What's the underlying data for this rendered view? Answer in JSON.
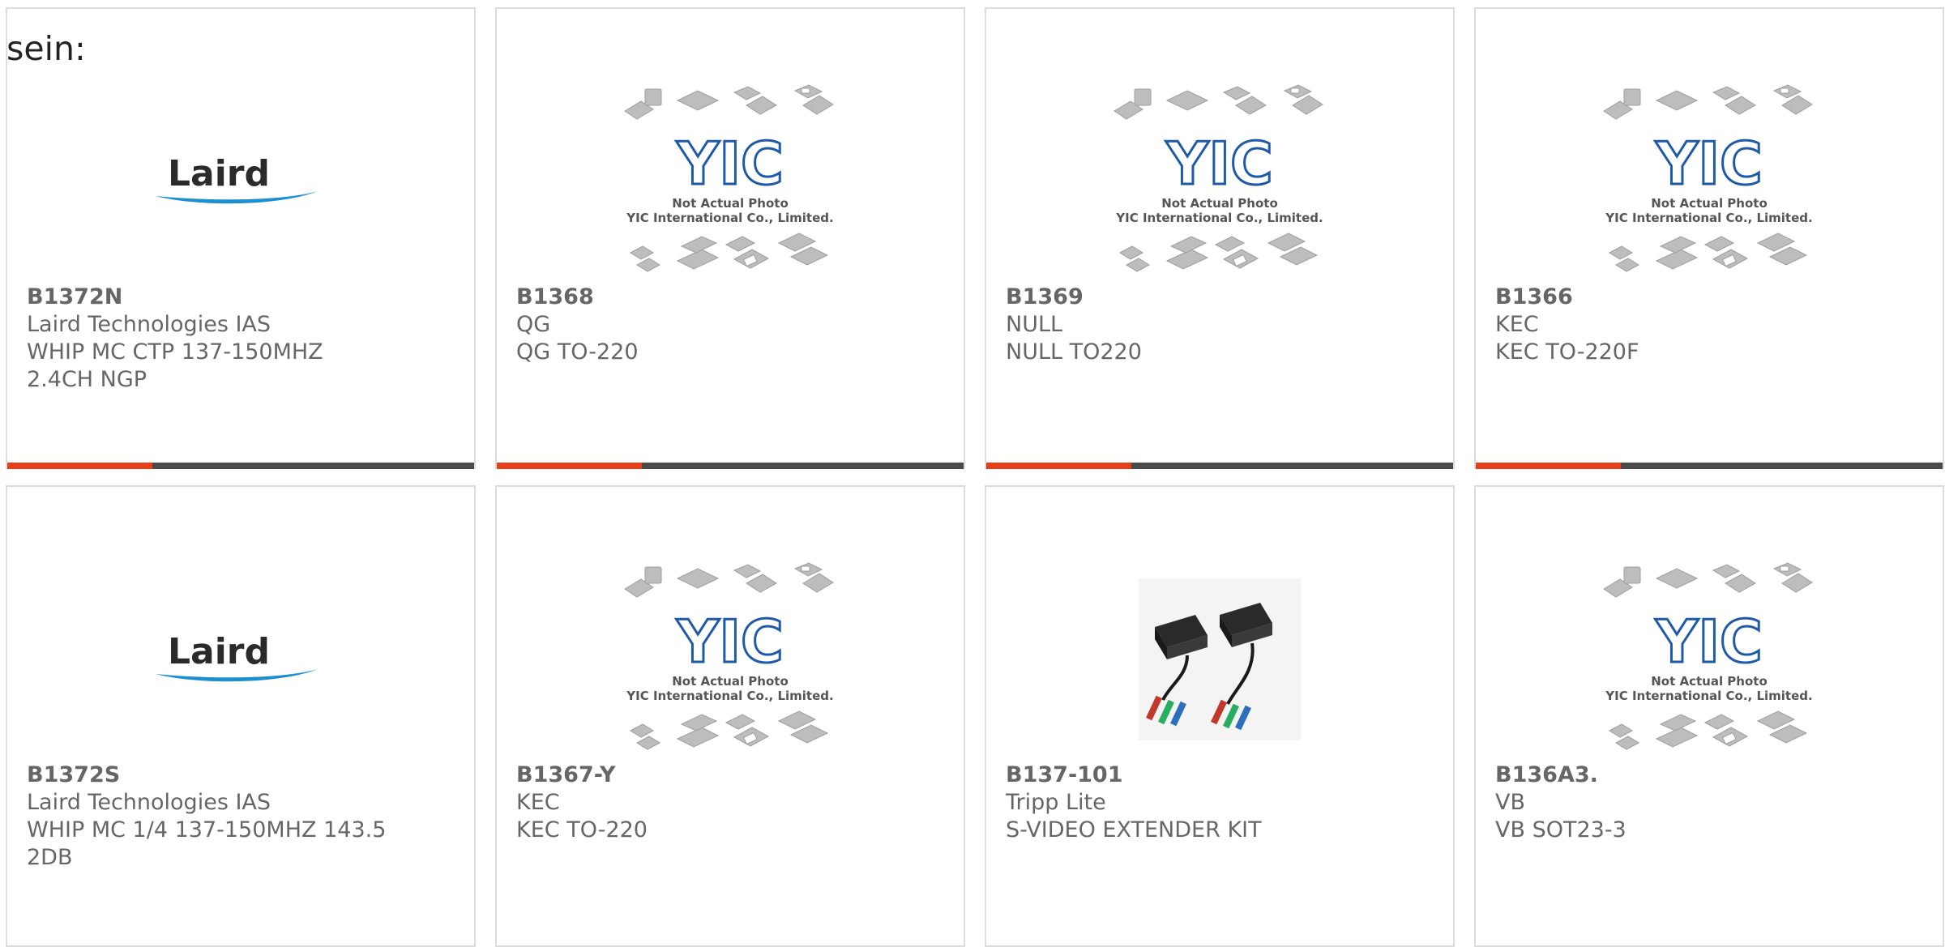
{
  "intro_text": "sein:",
  "photo_caption": {
    "line1": "Not Actual Photo",
    "line2": "YIC International Co., Limited.",
    "logo": "YIC"
  },
  "laird_logo": "Laird",
  "colors": {
    "accent_bar": "#e5401a",
    "bar_track": "#4a4a4a",
    "card_border": "#dcdcdc",
    "text": "#666666"
  },
  "products": [
    {
      "part": "B1372N",
      "manufacturer": "Laird Technologies IAS",
      "desc_line1": "WHIP MC CTP 137-150MHZ",
      "desc_line2": "2.4CH NGP",
      "image": "laird-logo",
      "progress_fraction": 0.31
    },
    {
      "part": "B1368",
      "manufacturer": "QG",
      "desc_line1": "QG TO-220",
      "desc_line2": "",
      "image": "yic-placeholder",
      "progress_fraction": 0.31
    },
    {
      "part": "B1369",
      "manufacturer": "NULL",
      "desc_line1": "NULL TO220",
      "desc_line2": "",
      "image": "yic-placeholder",
      "progress_fraction": 0.31
    },
    {
      "part": "B1366",
      "manufacturer": "KEC",
      "desc_line1": "KEC TO-220F",
      "desc_line2": "",
      "image": "yic-placeholder",
      "progress_fraction": 0.31
    },
    {
      "part": "B1372S",
      "manufacturer": "Laird Technologies IAS",
      "desc_line1": "WHIP MC 1/4 137-150MHZ 143.5",
      "desc_line2": "2DB",
      "image": "laird-logo"
    },
    {
      "part": "B1367-Y",
      "manufacturer": "KEC",
      "desc_line1": "KEC TO-220",
      "desc_line2": "",
      "image": "yic-placeholder"
    },
    {
      "part": "B137-101",
      "manufacturer": "Tripp Lite",
      "desc_line1": "S-VIDEO EXTENDER KIT",
      "desc_line2": "",
      "image": "video-extender-photo"
    },
    {
      "part": "B136A3.",
      "manufacturer": "VB",
      "desc_line1": "VB SOT23-3",
      "desc_line2": "",
      "image": "yic-placeholder"
    }
  ]
}
